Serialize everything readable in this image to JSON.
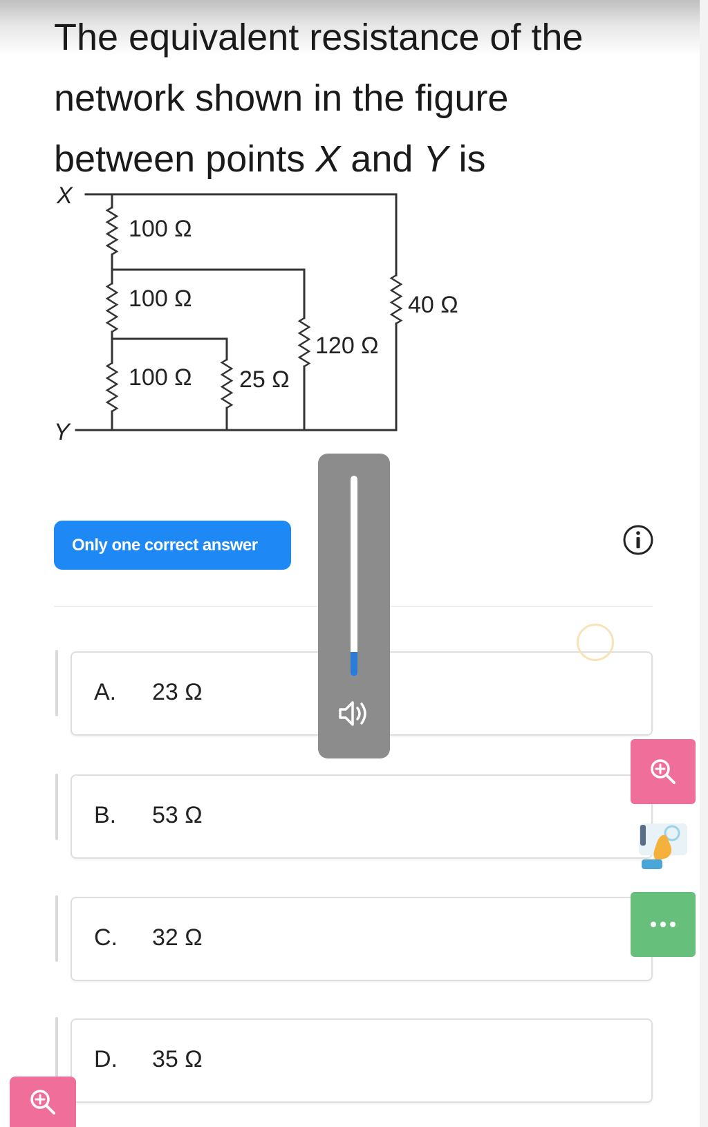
{
  "question": {
    "line1": "The equivalent resistance of the",
    "line2": "network shown in the figure",
    "line3_pre": "between points ",
    "var_x": "X",
    "line3_mid": " and ",
    "var_y": "Y",
    "line3_post": " is"
  },
  "circuit": {
    "node_top": "X",
    "node_bottom": "Y",
    "resistors": [
      "100 Ω",
      "100 Ω",
      "100 Ω",
      "25 Ω",
      "120 Ω",
      "40 Ω"
    ]
  },
  "answer_mode": "Only one correct answer",
  "options": [
    {
      "letter": "A.",
      "value": "23 Ω"
    },
    {
      "letter": "B.",
      "value": "53 Ω"
    },
    {
      "letter": "C.",
      "value": "32 Ω"
    },
    {
      "letter": "D.",
      "value": "35 Ω"
    }
  ],
  "volume_level": 0.12,
  "icons": {
    "info": "info-icon",
    "zoom": "zoom-in-icon",
    "more": "more-dots-icon",
    "speaker": "speaker-icon",
    "hand": "hand-pointer-icon"
  },
  "colors": {
    "accent_blue": "#1e88f5",
    "zoom_pink": "#f06e9a",
    "more_green": "#67bf7c",
    "volume_panel": "#8c8c8c"
  }
}
